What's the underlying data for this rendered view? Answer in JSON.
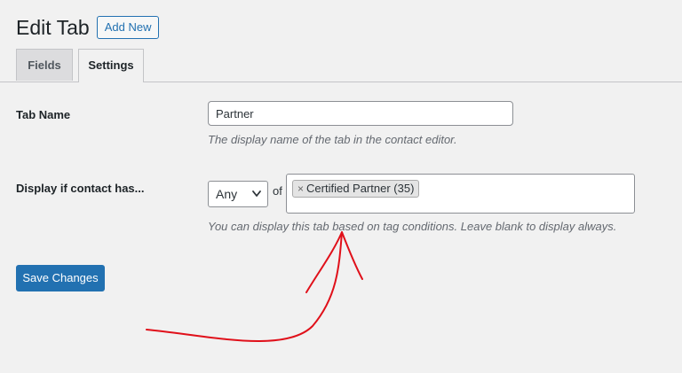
{
  "header": {
    "title": "Edit Tab",
    "add_new_label": "Add New"
  },
  "tabs": [
    {
      "label": "Fields",
      "active": false
    },
    {
      "label": "Settings",
      "active": true
    }
  ],
  "form": {
    "tab_name": {
      "label": "Tab Name",
      "value": "Partner",
      "description": "The display name of the tab in the contact editor."
    },
    "display_condition": {
      "label": "Display if contact has...",
      "select_value": "Any",
      "of_text": "of",
      "tags": [
        {
          "label": "Certified Partner (35)",
          "remove_glyph": "×"
        }
      ],
      "description": "You can display this tab based on tag conditions. Leave blank to display always."
    }
  },
  "actions": {
    "save_label": "Save Changes"
  },
  "colors": {
    "accent": "#2271b1",
    "annotation": "#e0101a",
    "background": "#f1f1f1"
  },
  "icons": {
    "select_chevron": "chevron-down-icon",
    "tag_remove": "close-icon"
  }
}
